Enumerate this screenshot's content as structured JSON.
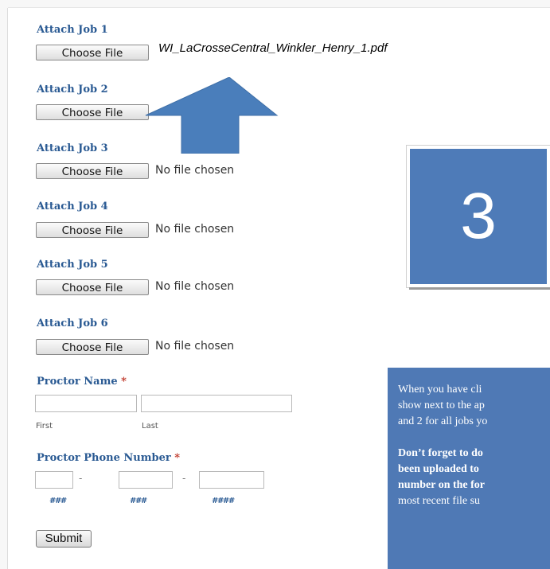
{
  "attach_jobs": [
    {
      "label": "Attach Job 1",
      "button": "Choose File",
      "status": "WI_LaCrosseCentral_Winkler_Henry_1.pdf"
    },
    {
      "label": "Attach Job 2",
      "button": "Choose File",
      "status": ""
    },
    {
      "label": "Attach Job 3",
      "button": "Choose File",
      "status": "No file chosen"
    },
    {
      "label": "Attach Job 4",
      "button": "Choose File",
      "status": "No file chosen"
    },
    {
      "label": "Attach Job 5",
      "button": "Choose File",
      "status": "No file chosen"
    },
    {
      "label": "Attach Job 6",
      "button": "Choose File",
      "status": "No file chosen"
    }
  ],
  "proctor_name": {
    "label": "Proctor Name",
    "required_mark": "*",
    "first_label": "First",
    "last_label": "Last"
  },
  "proctor_phone": {
    "label": "Proctor Phone Number",
    "required_mark": "*",
    "separator": "-",
    "hint1": "###",
    "hint2": "###",
    "hint3": "####"
  },
  "submit_label": "Submit",
  "step_number": "3",
  "info": {
    "line1": "When you have cli",
    "line2": "show next to the ap",
    "line3": "and 2 for all jobs yo",
    "bold1": "Don’t forget to do",
    "bold2": "been uploaded to",
    "bold3": "number on the for",
    "line4": "most recent file su"
  },
  "colors": {
    "label_blue": "#2a5a93",
    "arrow_blue": "#4a7ebb",
    "box_blue": "#4e7bb8",
    "required_red": "#c0392b"
  }
}
